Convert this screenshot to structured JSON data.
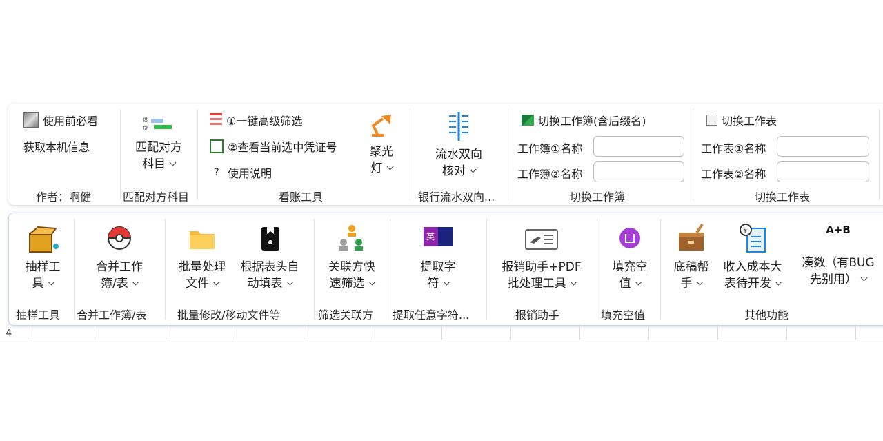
{
  "ribbon_top": {
    "group_author": {
      "item_must_read": "使用前必看",
      "item_machine_info": "获取本机信息",
      "label": "作者：啊健"
    },
    "group_match": {
      "button": "匹配对方科目",
      "button_line1": "匹配对方",
      "button_line2": "科目",
      "label": "匹配对方科目"
    },
    "group_audit": {
      "item_filter": "①一键高级筛选",
      "item_voucher": "②查看当前选中凭证号",
      "item_help": "使用说明",
      "spotlight_line1": "聚光",
      "spotlight_line2": "灯",
      "label": "看账工具"
    },
    "group_bank": {
      "line1": "流水双向",
      "line2": "核对",
      "label": "银行流水双向..."
    },
    "group_switch_book": {
      "title": "切换工作簿(含后缀名)",
      "field1_label": "工作簿①名称",
      "field2_label": "工作簿②名称",
      "label": "切换工作簿"
    },
    "group_switch_sheet": {
      "title": "切换工作表",
      "field1_label": "工作表①名称",
      "field2_label": "工作表②名称",
      "label": "切换工作表"
    }
  },
  "ribbon_bottom": {
    "sample": {
      "line1": "抽样工",
      "line2": "具",
      "label": "抽样工具"
    },
    "merge": {
      "line1": "合并工作",
      "line2": "簿/表",
      "label": "合并工作簿/表"
    },
    "batch": {
      "line1": "批量处理",
      "line2": "文件",
      "label": "批量修改/移动文件等"
    },
    "header_fill": {
      "line1": "根据表头自",
      "line2": "动填表"
    },
    "filter_rel": {
      "line1": "关联方快",
      "line2": "速筛选",
      "label": "筛选关联方"
    },
    "extract": {
      "line1": "提取字",
      "line2": "符",
      "label": "提取任意字符...",
      "icon_text": "英"
    },
    "reimburse": {
      "line1": "报销助手+PDF",
      "line2": "批处理工具",
      "label": "报销助手"
    },
    "fill_blank": {
      "line1": "填充空",
      "line2": "值",
      "label": "填充空值"
    },
    "draft": {
      "line1": "底稿帮",
      "line2": "手"
    },
    "income": {
      "line1": "收入成本大",
      "line2": "表待开发"
    },
    "round": {
      "line1": "凑数（有BUG",
      "line2": "先别用）",
      "icon_text": "A+B"
    },
    "other_label": "其他功能"
  },
  "sheet": {
    "row_number": "4"
  },
  "colors": {
    "accent_border": "#c5d8ef",
    "separator": "#e3e3e3"
  }
}
